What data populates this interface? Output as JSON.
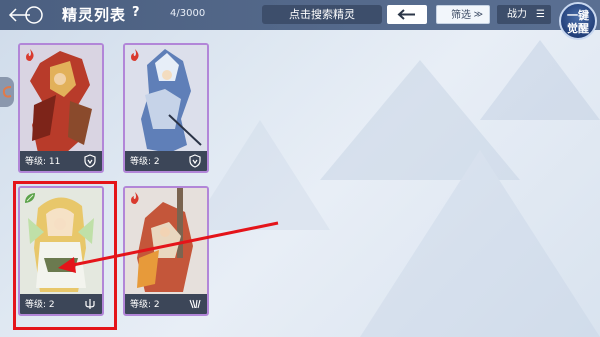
{
  "header": {
    "title": "精灵列表",
    "help_label": "?",
    "count": "4/3000",
    "search_label": "点击搜索精灵",
    "filter_label": "筛选",
    "power_label": "战力",
    "awaken_line1": "一键",
    "awaken_line2": "觉醒"
  },
  "cards": [
    {
      "level_label": "等级: 11",
      "element": "fire-icon",
      "accent": "#b286d8"
    },
    {
      "level_label": "等级: 2",
      "element": "fire-icon",
      "accent": "#b286d8"
    },
    {
      "level_label": "等级: 2",
      "element": "leaf-icon",
      "accent": "#b286d8"
    },
    {
      "level_label": "等级: 2",
      "element": "fire-icon",
      "accent": "#b286d8"
    }
  ],
  "colors": {
    "topbar": "#4b5f80",
    "card_border": "#b286d8",
    "highlight": "#e4141a"
  }
}
